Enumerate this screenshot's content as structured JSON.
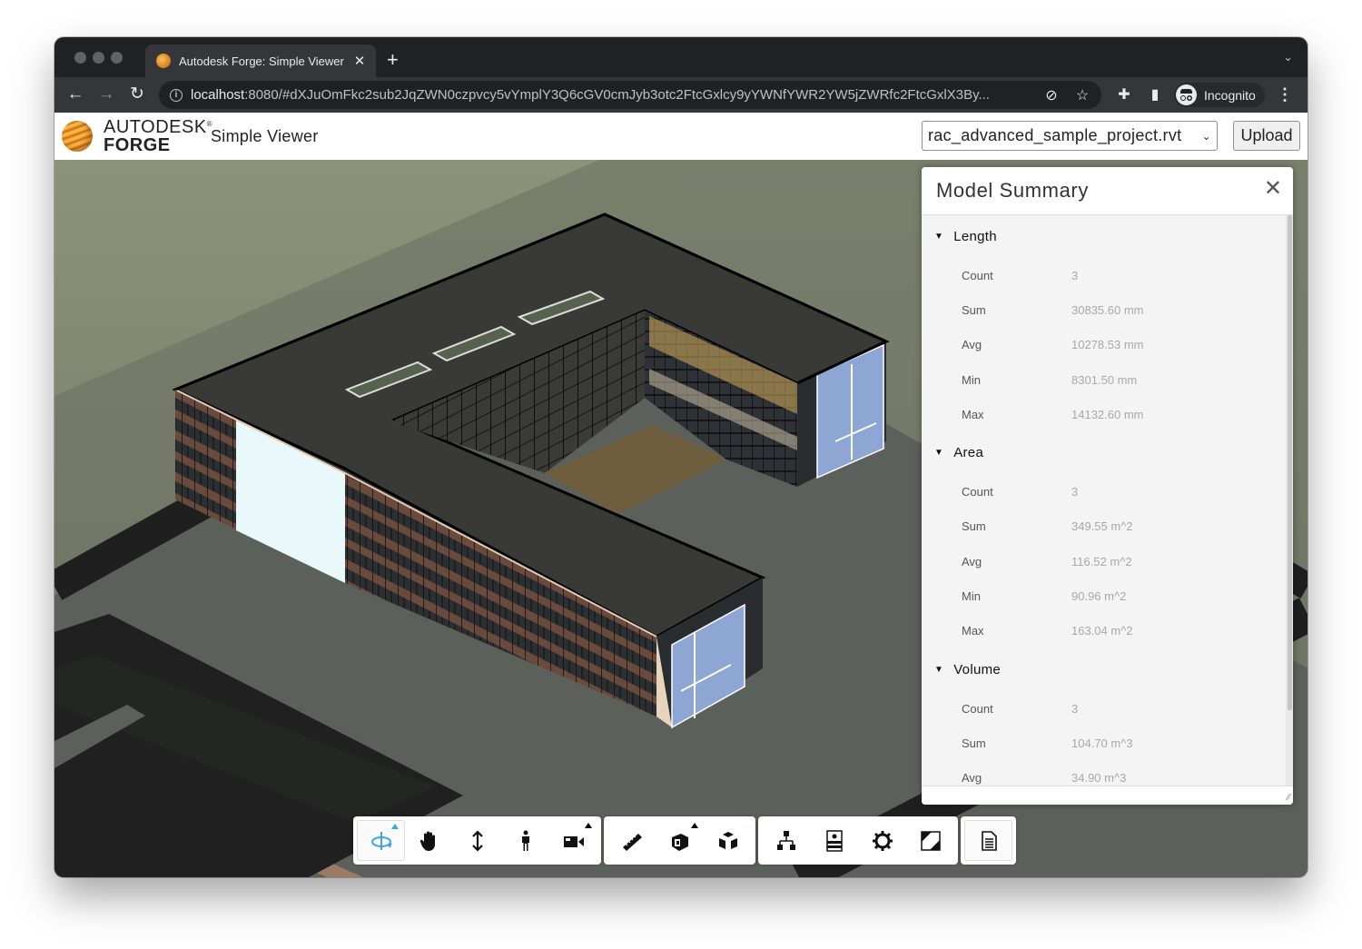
{
  "browser": {
    "tab_title": "Autodesk Forge: Simple Viewer",
    "tab_close": "✕",
    "new_tab": "+",
    "url_host": "localhost",
    "url_rest": ":8080/#dXJuOmFkc2sub2JqZWN0czpvcy5vYmplY3Q6cGV0cmJyb3otc2FtcGxlcy9yYWNfYWR2YW5jZWRfc2FtcGxlX3By...",
    "profile_label": "Incognito"
  },
  "app": {
    "brand_top": "AUTODESK",
    "brand_reg": "®",
    "brand_bottom": "FORGE",
    "title": "Simple Viewer",
    "model_select_value": "rac_advanced_sample_project.rvt",
    "upload_label": "Upload"
  },
  "panel": {
    "title": "Model Summary",
    "groups": [
      {
        "name": "Length",
        "rows": [
          {
            "label": "Count",
            "value": "3"
          },
          {
            "label": "Sum",
            "value": "30835.60 mm"
          },
          {
            "label": "Avg",
            "value": "10278.53 mm"
          },
          {
            "label": "Min",
            "value": "8301.50 mm"
          },
          {
            "label": "Max",
            "value": "14132.60 mm"
          }
        ]
      },
      {
        "name": "Area",
        "rows": [
          {
            "label": "Count",
            "value": "3"
          },
          {
            "label": "Sum",
            "value": "349.55 m^2"
          },
          {
            "label": "Avg",
            "value": "116.52 m^2"
          },
          {
            "label": "Min",
            "value": "90.96 m^2"
          },
          {
            "label": "Max",
            "value": "163.04 m^2"
          }
        ]
      },
      {
        "name": "Volume",
        "rows": [
          {
            "label": "Count",
            "value": "3"
          },
          {
            "label": "Sum",
            "value": "104.70 m^3"
          },
          {
            "label": "Avg",
            "value": "34.90 m^3"
          }
        ]
      }
    ]
  },
  "toolbar": {
    "groups": [
      [
        "orbit",
        "pan",
        "dolly",
        "first-person",
        "camera"
      ],
      [
        "measure",
        "section",
        "explode"
      ],
      [
        "model-browser",
        "properties",
        "settings",
        "fullscreen"
      ],
      [
        "model-summary"
      ]
    ],
    "active_tool": "orbit",
    "accent_color": "#3ca5e8"
  }
}
